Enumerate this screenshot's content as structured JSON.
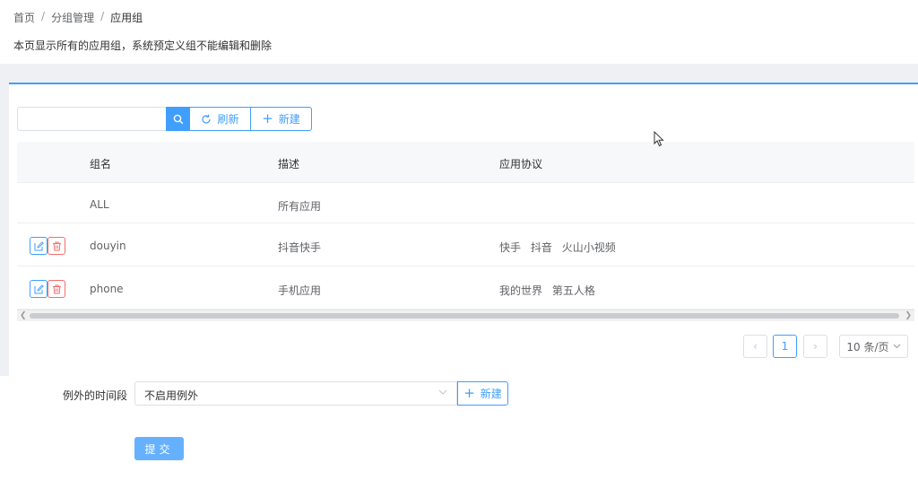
{
  "breadcrumb": {
    "items": [
      "首页",
      "分组管理",
      "应用组"
    ],
    "separator": "/"
  },
  "page": {
    "description": "本页显示所有的应用组，系统预定义组不能编辑和删除"
  },
  "toolbar": {
    "search_placeholder": "",
    "refresh_label": "刷新",
    "new_label": "新建"
  },
  "table": {
    "columns": [
      "组名",
      "描述",
      "应用协议"
    ],
    "rows": [
      {
        "name": "ALL",
        "desc": "所有应用",
        "protocols": []
      },
      {
        "name": "douyin",
        "desc": "抖音快手",
        "protocols": [
          "快手",
          "抖音",
          "火山小视频"
        ]
      },
      {
        "name": "phone",
        "desc": "手机应用",
        "protocols": [
          "我的世界",
          "第五人格"
        ]
      }
    ]
  },
  "pagination": {
    "current_page": "1",
    "page_size": "10 条/页"
  },
  "form": {
    "exception_label": "例外的时间段",
    "exception_value": "不启用例外",
    "new_label": "新建",
    "submit_label": "提交"
  },
  "colors": {
    "primary": "#409eff",
    "danger": "#f56c6c",
    "submit_bg": "#66b1ff"
  }
}
